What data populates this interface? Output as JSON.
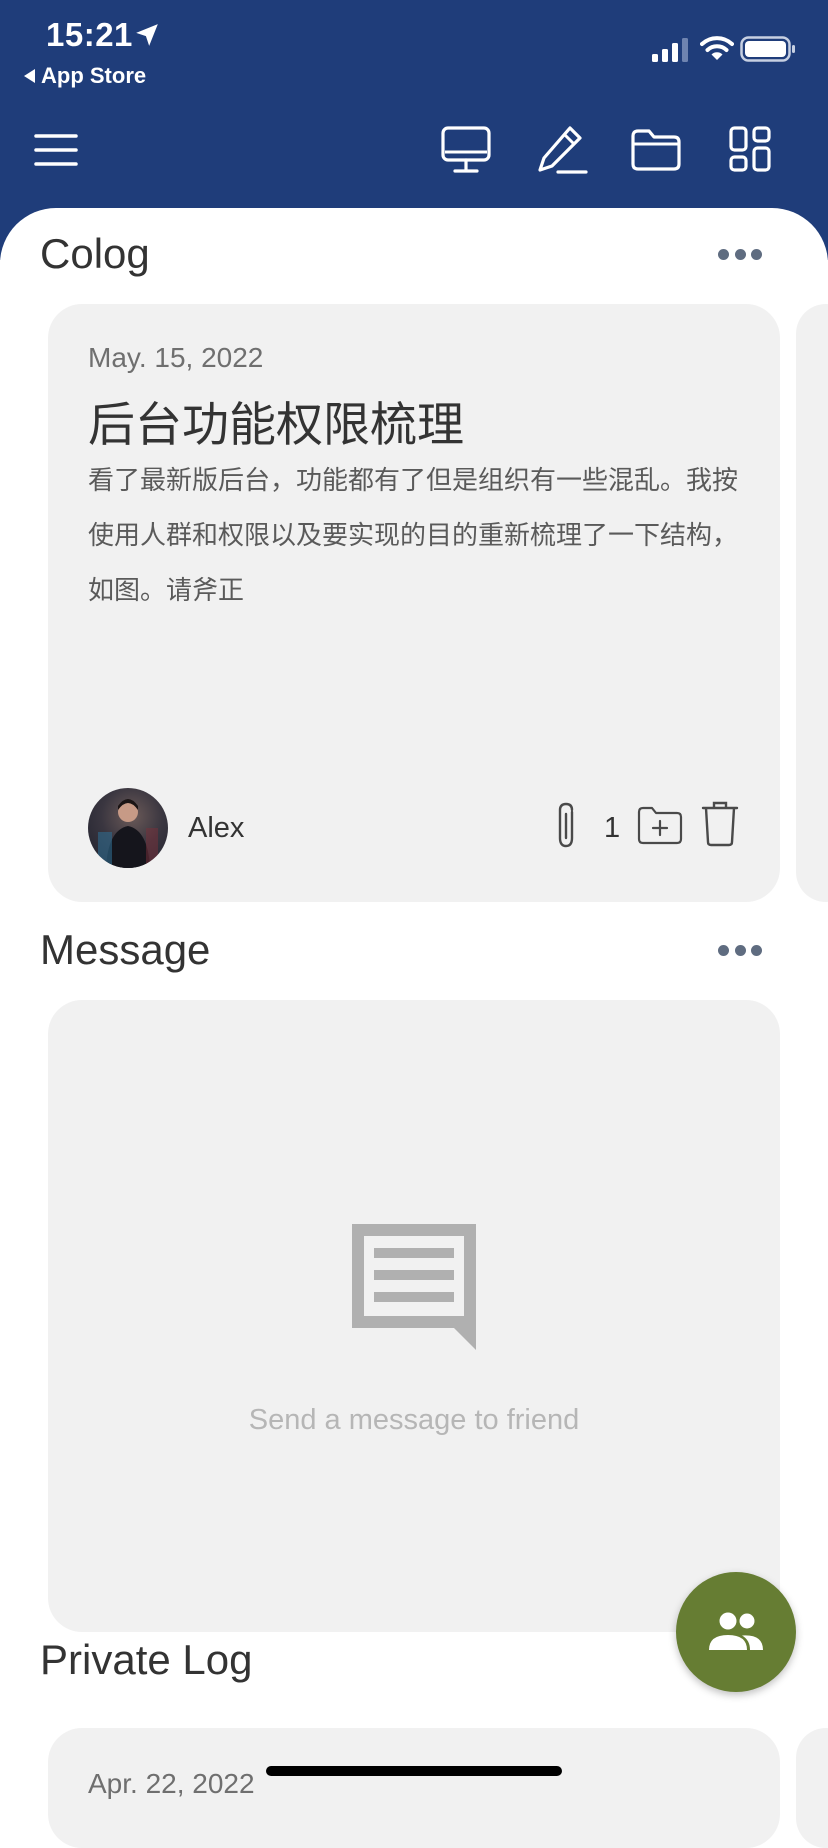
{
  "status_bar": {
    "time": "15:21",
    "back_app": "App Store"
  },
  "toolbar": {
    "icons": [
      "menu-icon",
      "desktop-icon",
      "edit-icon",
      "folder-icon",
      "grid-icon"
    ]
  },
  "sections": {
    "colog": {
      "title": "Colog",
      "card": {
        "date": "May. 15, 2022",
        "title": "后台功能权限梳理",
        "body": "看了最新版后台，功能都有了但是组织有一些混乱。我按使用人群和权限以及要实现的目的重新梳理了一下结构，如图。请斧正",
        "author": "Alex",
        "attachment_count": "1"
      }
    },
    "message": {
      "title": "Message",
      "empty_text": "Send a message to friend"
    },
    "private_log": {
      "title": "Private Log",
      "card": {
        "date": "Apr. 22, 2022"
      }
    }
  },
  "colors": {
    "header_blue": "#1f3d7a",
    "card_gray": "#f1f1f1",
    "fab_green": "#667d33"
  }
}
